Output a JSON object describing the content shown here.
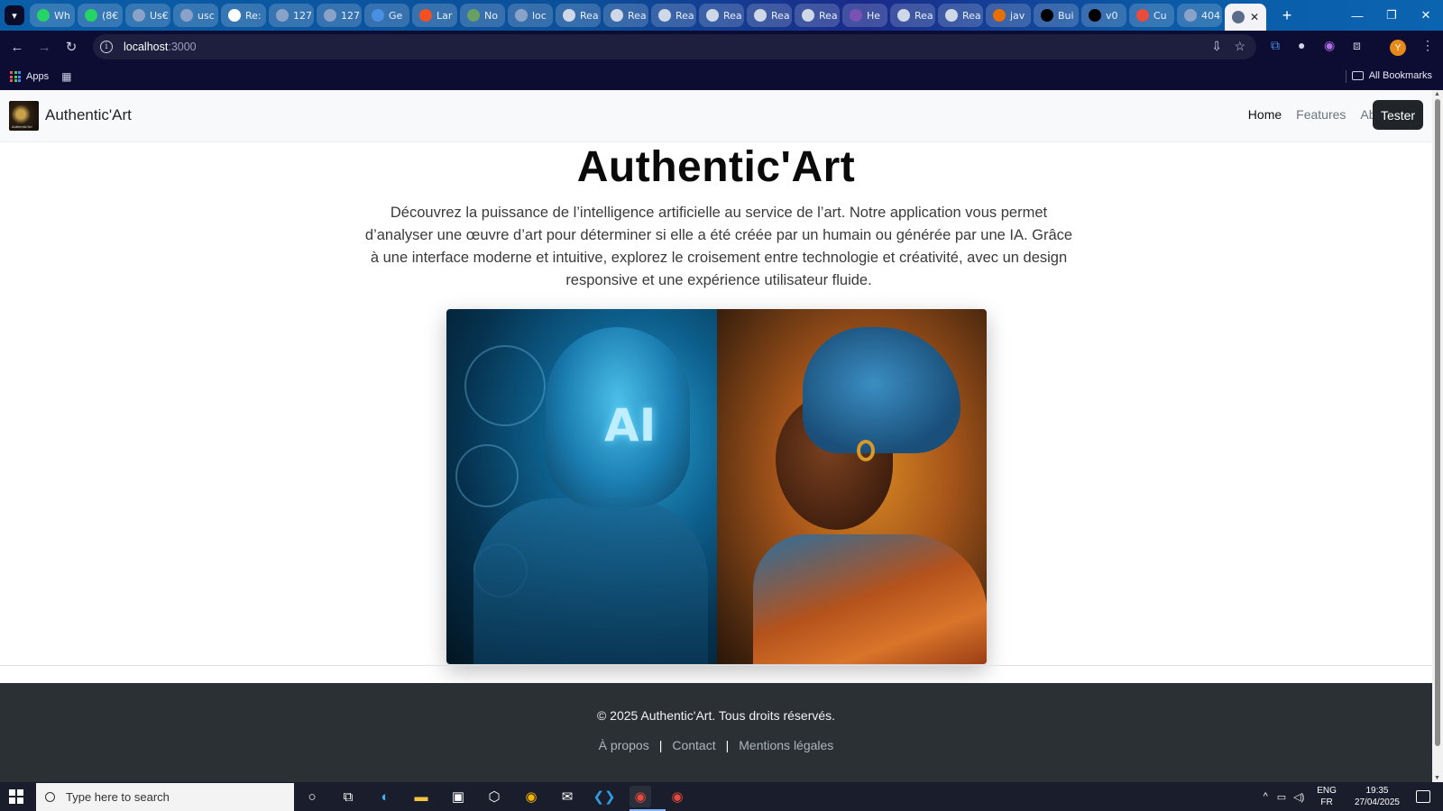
{
  "browser": {
    "tabs": [
      {
        "label": "Wh",
        "icon": "whatsapp-icon",
        "color": "#25d366"
      },
      {
        "label": "(8€",
        "icon": "whatsapp-icon",
        "color": "#25d366"
      },
      {
        "label": "Us€",
        "icon": "globe-icon",
        "color": "#8ba2c8"
      },
      {
        "label": "usc",
        "icon": "globe-icon",
        "color": "#8ba2c8"
      },
      {
        "label": "Re:",
        "icon": "react-icon",
        "color": "#ffffff"
      },
      {
        "label": "127",
        "icon": "globe-icon",
        "color": "#8ba2c8"
      },
      {
        "label": "127",
        "icon": "globe-icon",
        "color": "#8ba2c8"
      },
      {
        "label": "Ge",
        "icon": "gemini-icon",
        "color": "#4a90e2"
      },
      {
        "label": "Lar",
        "icon": "microsoft-icon",
        "color": "#f25022"
      },
      {
        "label": "No",
        "icon": "node-icon",
        "color": "#68a063"
      },
      {
        "label": "loc",
        "icon": "globe-icon",
        "color": "#8ba2c8"
      },
      {
        "label": "Rea",
        "icon": "react-icon",
        "color": "#cfd8e6"
      },
      {
        "label": "Rea",
        "icon": "react-icon",
        "color": "#cfd8e6"
      },
      {
        "label": "Rea",
        "icon": "react-icon",
        "color": "#cfd8e6"
      },
      {
        "label": "Rea",
        "icon": "react-icon",
        "color": "#cfd8e6"
      },
      {
        "label": "Rea",
        "icon": "react-icon",
        "color": "#cfd8e6"
      },
      {
        "label": "Rea",
        "icon": "react-icon",
        "color": "#cfd8e6"
      },
      {
        "label": "He",
        "icon": "bootstrap-icon",
        "color": "#7952b3"
      },
      {
        "label": "Rea",
        "icon": "react-icon",
        "color": "#cfd8e6"
      },
      {
        "label": "Rea",
        "icon": "react-icon",
        "color": "#cfd8e6"
      },
      {
        "label": "jav",
        "icon": "java-icon",
        "color": "#e76f00"
      },
      {
        "label": "Bui",
        "icon": "nextjs-icon",
        "color": "#000000"
      },
      {
        "label": "v0",
        "icon": "v0-icon",
        "color": "#000000"
      },
      {
        "label": "Cu",
        "icon": "chart-icon",
        "color": "#e94b3c"
      },
      {
        "label": "404",
        "icon": "globe-icon",
        "color": "#8ba2c8"
      }
    ],
    "active_tab": {
      "icon": "react-icon",
      "close": "✕"
    },
    "new_tab": "+",
    "url": "localhost",
    "url_port": ":3000",
    "bookmarks": {
      "apps_label": "Apps",
      "all_bookmarks": "All Bookmarks"
    },
    "profile_initial": "Y"
  },
  "site": {
    "brand": "Authentic'Art",
    "logo_text": "Authentic'Art",
    "nav": {
      "home": "Home",
      "features": "Features",
      "about": "About",
      "tester": "Tester"
    },
    "hero": {
      "title": "Authentic'Art",
      "text": "Découvrez la puissance de l’intelligence artificielle au service de l’art. Notre application vous permet d’analyser une œuvre d’art pour déterminer si elle a été créée par un humain ou générée par une IA. Grâce à une interface moderne et intuitive, explorez le croisement entre technologie et créativité, avec un design responsive et une expérience utilisateur fluide.",
      "image_ai_label": "AI"
    },
    "footer": {
      "copyright": "© 2025 Authentic'Art. Tous droits réservés.",
      "links": [
        "À propos",
        "Contact",
        "Mentions légales"
      ],
      "separator": "|"
    }
  },
  "taskbar": {
    "search_placeholder": "Type here to search",
    "lang_top": "ENG",
    "lang_bottom": "FR",
    "time": "19:35",
    "date": "27/04/2025"
  },
  "colors": {
    "footer_bg": "#2b3035",
    "tester_bg": "#212529",
    "browser_chrome": "#0d0d33"
  }
}
